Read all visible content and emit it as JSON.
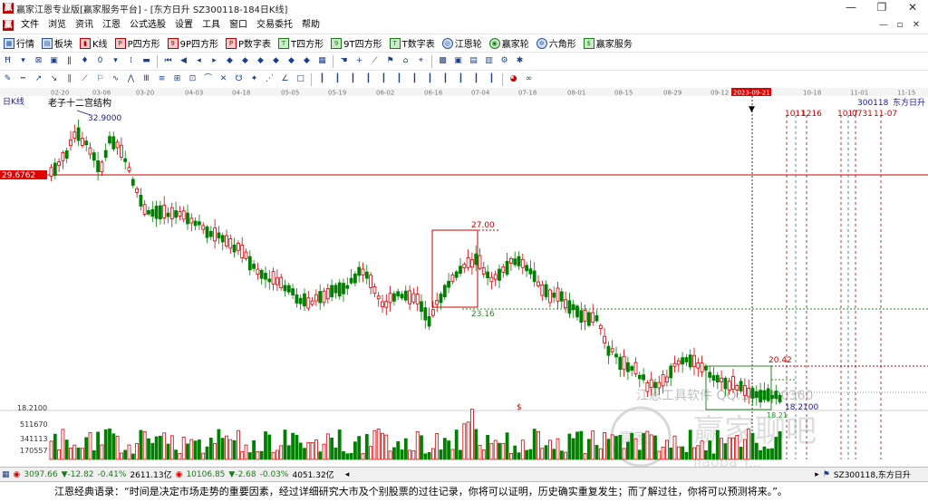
{
  "window": {
    "title": "赢家江恩专业版[赢家服务平台] - [东方日升  SZ300118-184日K线]",
    "controls": [
      "—",
      "❐",
      "✕"
    ]
  },
  "menu": [
    "文件",
    "浏览",
    "资讯",
    "江恩",
    "公式选股",
    "设置",
    "工具",
    "窗口",
    "交易委托",
    "帮助"
  ],
  "mdi_controls": [
    "—",
    "▫",
    "✕"
  ],
  "toolbar1": [
    {
      "label": "行情",
      "icon": "grid-icon"
    },
    {
      "label": "板块",
      "icon": "blocks-icon"
    },
    {
      "label": "K线",
      "icon": "kline-icon"
    },
    {
      "label": "P四方形",
      "icon": "p-square-icon"
    },
    {
      "label": "9P四方形",
      "icon": "9p-square-icon"
    },
    {
      "label": "P数字表",
      "icon": "p-table-icon"
    },
    {
      "label": "T四方形",
      "icon": "t-square-icon"
    },
    {
      "label": "9T四方形",
      "icon": "9t-square-icon"
    },
    {
      "label": "T数字表",
      "icon": "t-table-icon"
    },
    {
      "label": "江恩轮",
      "icon": "gann-wheel-icon"
    },
    {
      "label": "赢家轮",
      "icon": "winner-wheel-icon"
    },
    {
      "label": "六角形",
      "icon": "hexagon-icon"
    },
    {
      "label": "赢家服务",
      "icon": "service-icon"
    }
  ],
  "chart": {
    "period_label": "日K线",
    "stock_code": "300118",
    "stock_name": "东方日升",
    "date_ticks": [
      "02-20",
      "03-06",
      "03-20",
      "04-03",
      "04-18",
      "05-05",
      "05-19",
      "06-02",
      "06-16",
      "07-04",
      "07-18",
      "08-01",
      "08-15",
      "08-29",
      "09-12",
      "2023-09-21",
      "10-18",
      "11-01",
      "11-15"
    ],
    "highlighted_date": "2023-09-21",
    "pattern_label": "老子十二宫结构",
    "price_labels": {
      "high": "32.9000",
      "current_left": "29.6762",
      "box1_top": "27.00",
      "box1_bottom": "23.16",
      "box2_top": "20.42",
      "low_marker": "18.2100",
      "low_small": "18.21",
      "y_axis_low": "18.2100"
    },
    "future_dates": [
      "1011",
      "1216",
      "1017",
      "0731",
      "11-07"
    ],
    "volume_ticks": [
      "511670",
      "341113",
      "170557"
    ],
    "dollar_marker": "$",
    "watermark": {
      "line1": "江恩工具软件 QQ:100800360",
      "line2": "赢家聊吧",
      "line3": "Jiaoba Y..."
    }
  },
  "status": {
    "sh_index": "3097.66",
    "sh_change": "▼-12.82",
    "sh_pct": "-0.41%",
    "sh_amount": "2611.13亿",
    "sz_index": "10106.85",
    "sz_change": "▼-2.68",
    "sz_pct": "-0.03%",
    "sz_amount": "4051.32亿",
    "right_code": "SZ300118,东方日升"
  },
  "quote_text": "江恩经典语录：“时间是决定市场走势的重要因素，经过详细研究大市及个别股票的过往记录，你将可以证明，历史确实重复发生；而了解过往，你将可以预测将来。”。"
}
